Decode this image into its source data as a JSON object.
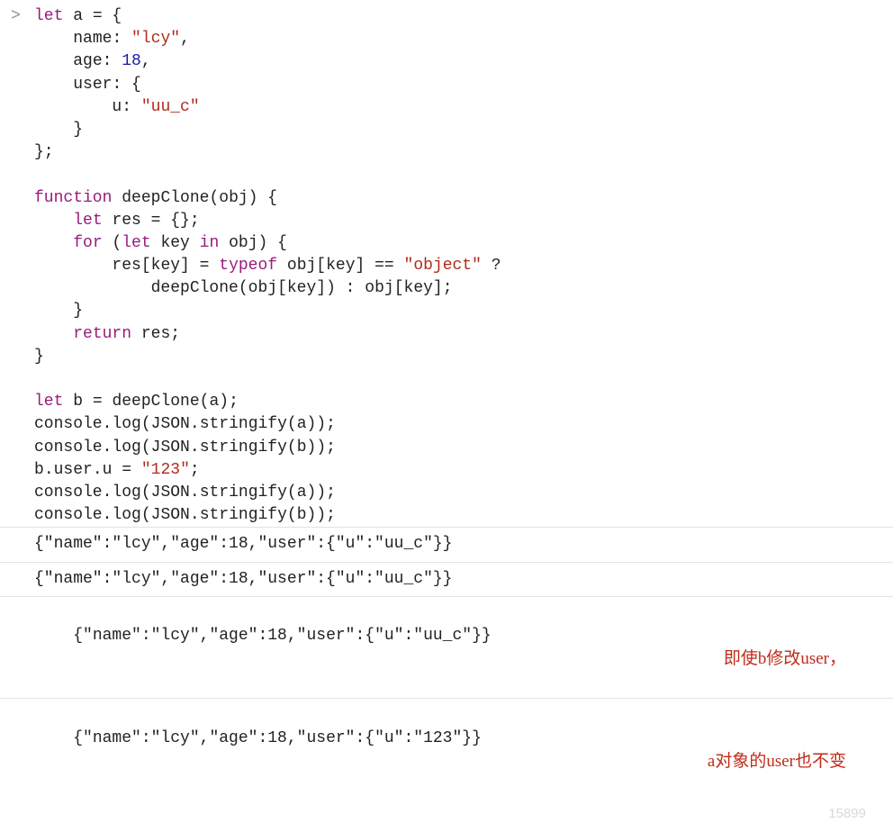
{
  "code": {
    "l01": "let a = {",
    "l02": "    name: \"lcy\",",
    "l03": "    age: 18,",
    "l04": "    user: {",
    "l05": "        u: \"uu_c\"",
    "l06": "    }",
    "l07": "};",
    "l08": "",
    "l09": "function deepClone(obj) {",
    "l10": "    let res = {};",
    "l11": "    for (let key in obj) {",
    "l12": "        res[key] = typeof obj[key] == \"object\" ?",
    "l13": "            deepClone(obj[key]) : obj[key];",
    "l14": "    }",
    "l15": "    return res;",
    "l16": "}",
    "l17": "",
    "l18": "let b = deepClone(a);",
    "l19": "console.log(JSON.stringify(a));",
    "l20": "console.log(JSON.stringify(b));",
    "l21": "b.user.u = \"123\";",
    "l22": "console.log(JSON.stringify(a));",
    "l23": "console.log(JSON.stringify(b));"
  },
  "tokens": {
    "kw_let": "let",
    "kw_function": "function",
    "kw_for": "for",
    "kw_in": "in",
    "kw_return": "return",
    "kw_typeof": "typeof",
    "id_a": "a",
    "id_b": "b",
    "id_obj": "obj",
    "id_res": "res",
    "id_key": "key",
    "id_deepClone": "deepClone",
    "id_console": "console",
    "id_log": "log",
    "id_JSON": "JSON",
    "id_stringify": "stringify",
    "prop_name": "name",
    "prop_age": "age",
    "prop_user": "user",
    "prop_u": "u",
    "str_lcy": "\"lcy\"",
    "str_uu_c": "\"uu_c\"",
    "str_object": "\"object\"",
    "str_123": "\"123\"",
    "num_18": "18"
  },
  "output": {
    "o1": "{\"name\":\"lcy\",\"age\":18,\"user\":{\"u\":\"uu_c\"}}",
    "o2": "{\"name\":\"lcy\",\"age\":18,\"user\":{\"u\":\"uu_c\"}}",
    "o3": "{\"name\":\"lcy\",\"age\":18,\"user\":{\"u\":\"uu_c\"}}",
    "o4": "{\"name\":\"lcy\",\"age\":18,\"user\":{\"u\":\"123\"}}"
  },
  "annotations": {
    "a1": "即使b修改user，",
    "a2": "a对象的user也不变"
  },
  "prompt": ">",
  "watermark": "15899"
}
